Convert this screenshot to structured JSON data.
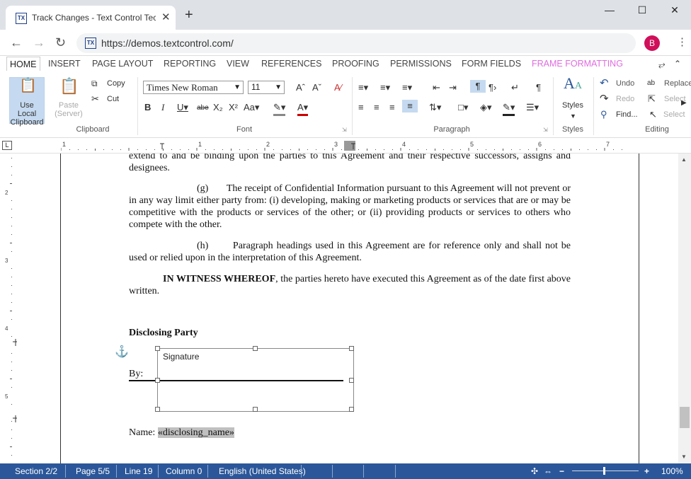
{
  "browser": {
    "tab_title": "Track Changes - Text Control Tec",
    "tab_close": "✕",
    "new_tab": "+",
    "url": "https://demos.textcontrol.com/",
    "avatar": "B",
    "minimize": "—",
    "maximize": "☐",
    "close": "✕",
    "favicon": "TX"
  },
  "ribbon_tabs": [
    "HOME",
    "INSERT",
    "PAGE LAYOUT",
    "REPORTING",
    "VIEW",
    "REFERENCES",
    "PROOFING",
    "PERMISSIONS",
    "FORM FIELDS",
    "FRAME FORMATTING"
  ],
  "clipboard": {
    "use_local": "Use Local Clipboard",
    "paste": "Paste (Server)",
    "copy": "Copy",
    "cut": "Cut",
    "group": "Clipboard"
  },
  "font": {
    "family": "Times New Roman",
    "size": "11",
    "group": "Font"
  },
  "paragraph": {
    "group": "Paragraph"
  },
  "styles": {
    "label": "Styles",
    "group": "Styles"
  },
  "editing": {
    "undo": "Undo",
    "redo": "Redo",
    "find": "Find...",
    "replace": "Replace",
    "select1": "Select",
    "select2": "Select",
    "group": "Editing"
  },
  "document": {
    "p1": "extend to and be binding upon the parties to this Agreement and their respective successors, assigns and designees.",
    "p2_marker": "(g)",
    "p2": "The receipt of Confidential Information pursuant to this Agreement will not prevent or in any way limit either party from: (i) developing, making or marketing products or services that are or may be competitive with the products or services of the other; or (ii) providing products or services to others who compete with the other.",
    "p3_marker": "(h)",
    "p3": "Paragraph headings used in this Agreement are for reference only and shall not be used or relied upon in the interpretation of this Agreement.",
    "p4_bold": "IN WITNESS WHEREOF",
    "p4": ", the parties hereto have executed this Agreement as of the date first above written.",
    "heading": "Disclosing Party",
    "by": "By:",
    "signature": "Signature",
    "name_label": "Name:",
    "name_field": "«disclosing_name»"
  },
  "status": {
    "section": "Section 2/2",
    "page": "Page 5/5",
    "line": "Line 19",
    "column": "Column 0",
    "language": "English (United States)",
    "zoom": "100%"
  }
}
